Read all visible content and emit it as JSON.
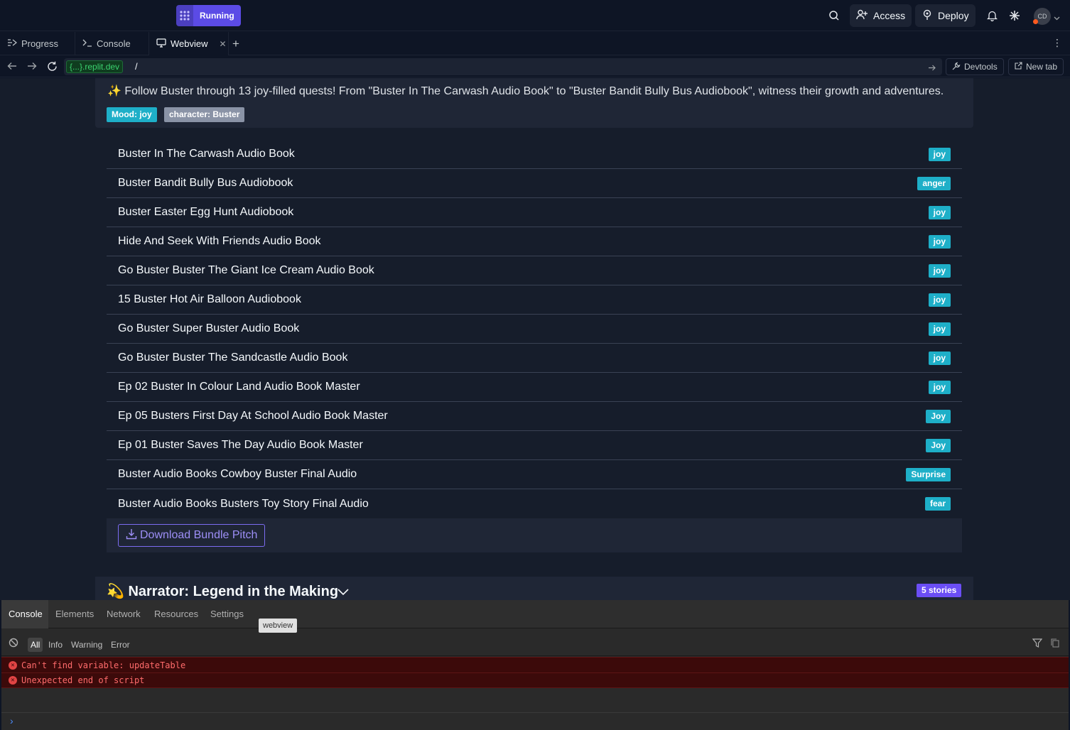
{
  "topbar": {
    "status_label": "Running",
    "access_label": "Access",
    "deploy_label": "Deploy",
    "avatar_initials": "CD"
  },
  "tabs": [
    {
      "label": "Progress"
    },
    {
      "label": "Console"
    },
    {
      "label": "Webview"
    }
  ],
  "address": {
    "domain": "{...}.replit.dev",
    "path": "/",
    "devtools_label": "Devtools",
    "newtab_label": "New tab"
  },
  "webview": {
    "description": "✨ Follow Buster through 13 joy-filled quests! From \"Buster In The Carwash Audio Book\" to \"Buster Bandit Bully Bus Audiobook\", witness their growth and adventures.",
    "tags": [
      {
        "label": "Mood: joy",
        "color": "#1eafc8"
      },
      {
        "label": "character: Buster",
        "color": "#8a93a6"
      }
    ],
    "stories": [
      {
        "title": "Buster In The Carwash Audio Book",
        "mood": "joy"
      },
      {
        "title": "Buster Bandit Bully Bus Audiobook",
        "mood": "anger"
      },
      {
        "title": "Buster Easter Egg Hunt Audiobook",
        "mood": "joy"
      },
      {
        "title": "Hide And Seek With Friends Audio Book",
        "mood": "joy"
      },
      {
        "title": "Go Buster Buster The Giant Ice Cream Audio Book",
        "mood": "joy"
      },
      {
        "title": "15 Buster Hot Air Balloon Audiobook",
        "mood": "joy"
      },
      {
        "title": "Go Buster Super Buster Audio Book",
        "mood": "joy"
      },
      {
        "title": "Go Buster Buster The Sandcastle Audio Book",
        "mood": "joy"
      },
      {
        "title": "Ep 02 Buster In Colour Land Audio Book Master",
        "mood": "joy"
      },
      {
        "title": "Ep 05 Busters First Day At School Audio Book Master",
        "mood": "Joy"
      },
      {
        "title": "Ep 01 Buster Saves The Day Audio Book Master",
        "mood": "Joy"
      },
      {
        "title": "Buster Audio Books Cowboy Buster Final Audio",
        "mood": "Surprise"
      },
      {
        "title": "Buster Audio Books Busters Toy Story Final Audio",
        "mood": "fear"
      }
    ],
    "download_label": "Download Bundle Pitch",
    "narrator_title": "💫 Narrator: Legend in the Making",
    "narrator_badge": "5 stories"
  },
  "devtools": {
    "tabs": [
      "Console",
      "Elements",
      "Network",
      "Resources",
      "Settings"
    ],
    "tooltip": "webview",
    "filters": [
      "All",
      "Info",
      "Warning",
      "Error"
    ],
    "errors": [
      "Can't find variable: updateTable",
      "Unexpected end of script"
    ]
  }
}
